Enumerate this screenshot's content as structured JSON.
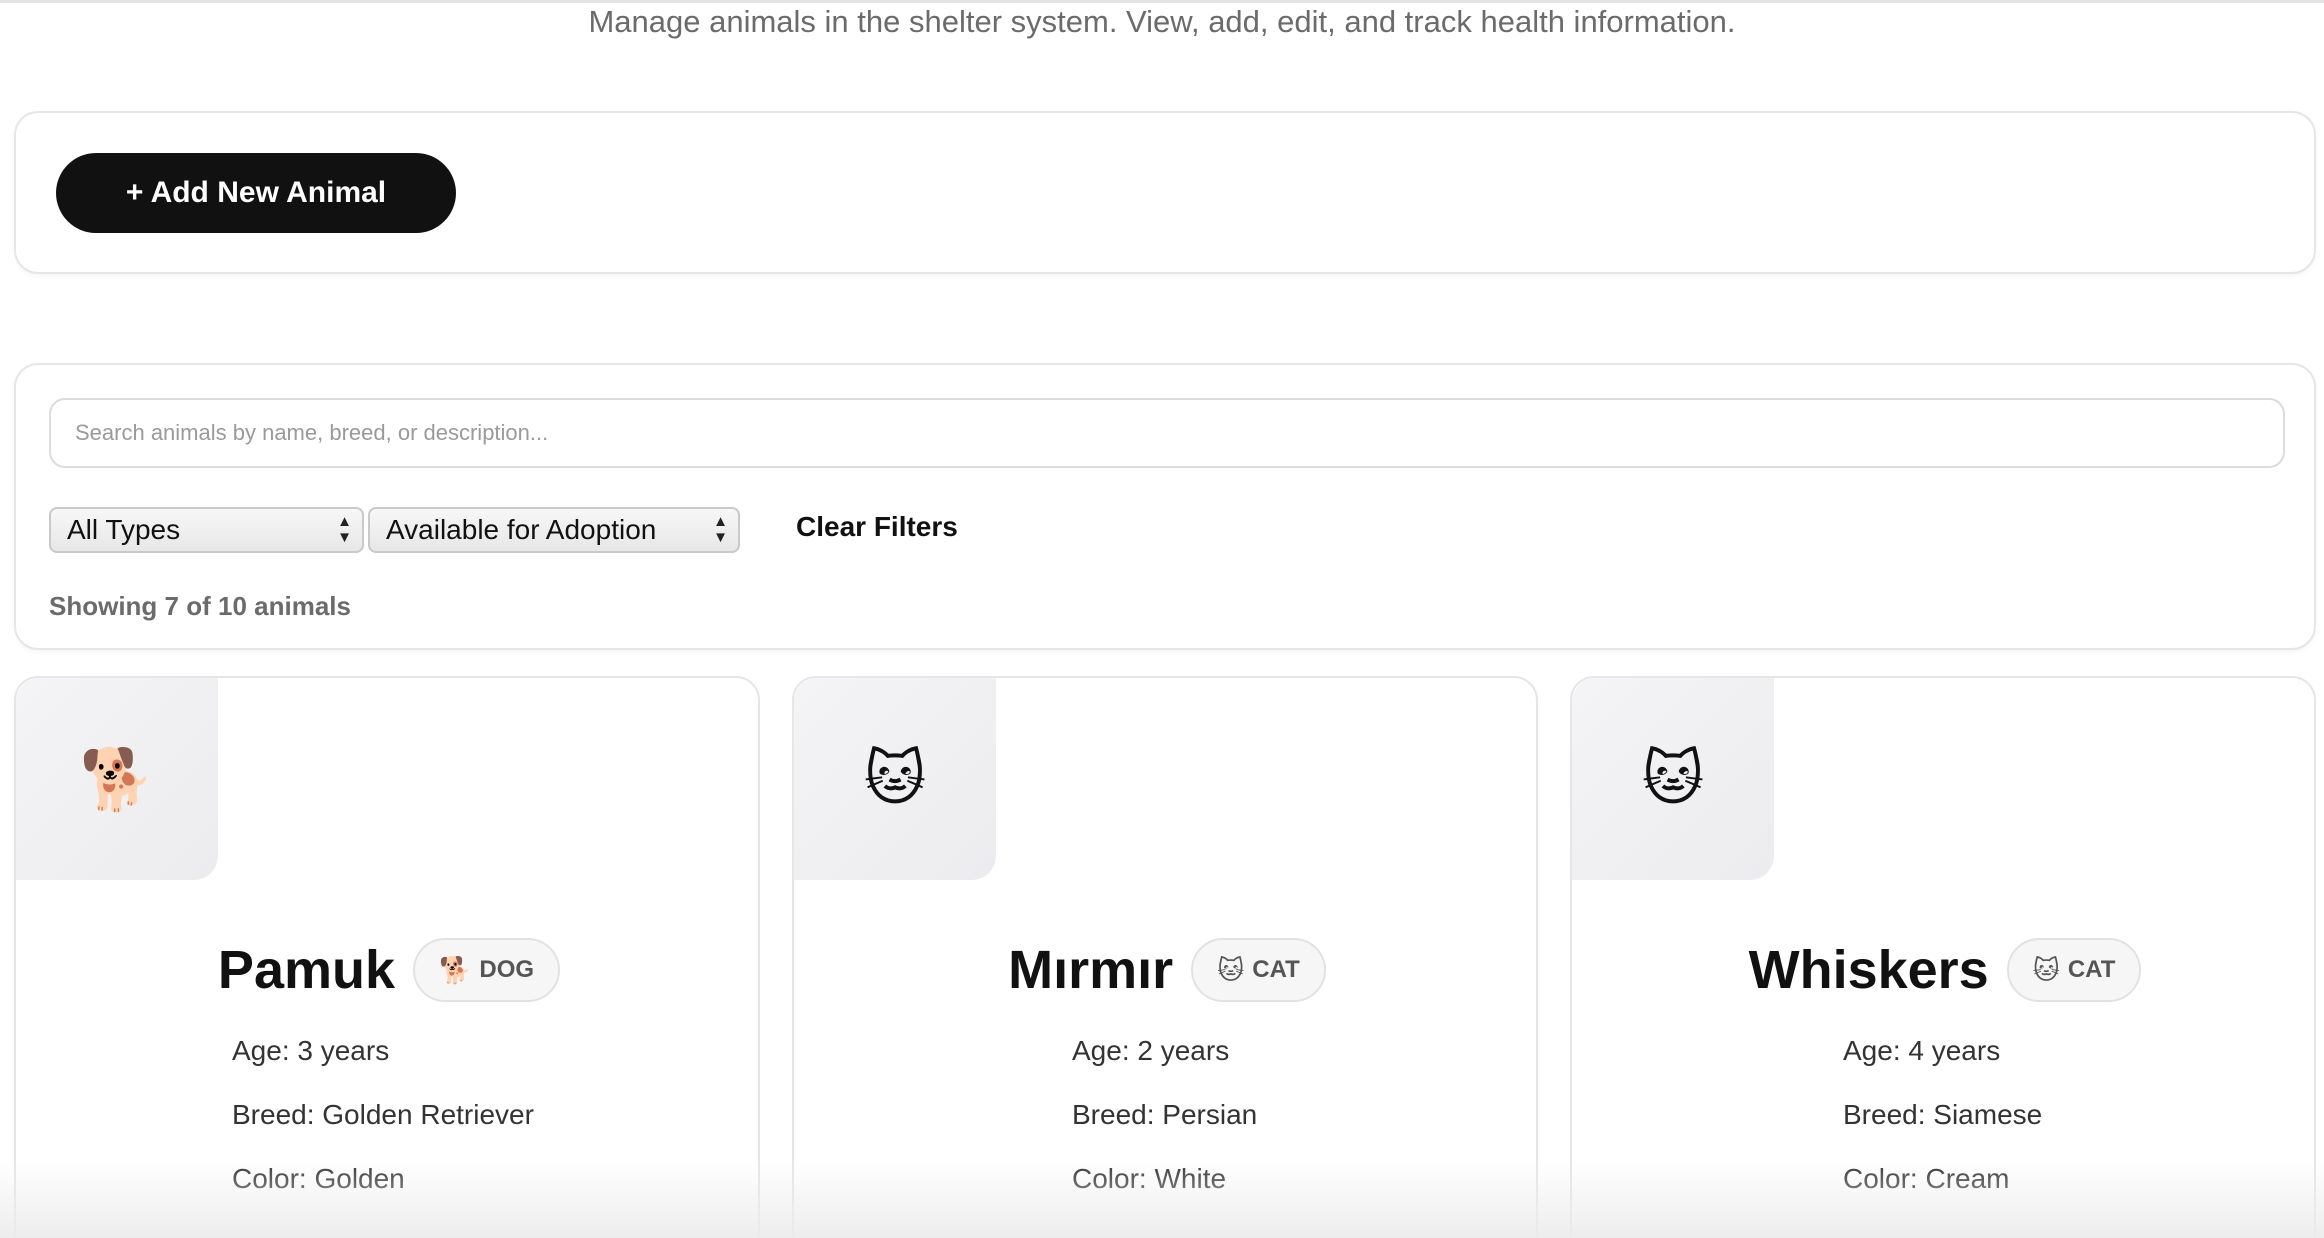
{
  "header": {
    "subtitle": "Manage animals in the shelter system. View, add, edit, and track health information."
  },
  "actions": {
    "add_label": "+ Add New Animal"
  },
  "filters": {
    "search_placeholder": "Search animals by name, breed, or description...",
    "type_selected": "All Types",
    "status_selected": "Available for Adoption",
    "clear_label": "Clear Filters",
    "count_text": "Showing 7 of 10 animals"
  },
  "animals": [
    {
      "name": "Pamuk",
      "type_label": "DOG",
      "type_icon": "dog-icon",
      "thumb_glyph": "🐕",
      "badge_glyph": "🐕",
      "age": "Age: 3 years",
      "breed": "Breed: Golden Retriever",
      "color": "Color: Golden"
    },
    {
      "name": "Mırmır",
      "type_label": "CAT",
      "type_icon": "cat-icon",
      "thumb_glyph": "🐱",
      "badge_glyph": "🐱",
      "age": "Age: 2 years",
      "breed": "Breed: Persian",
      "color": "Color: White"
    },
    {
      "name": "Whiskers",
      "type_label": "CAT",
      "type_icon": "cat-icon",
      "thumb_glyph": "🐱",
      "badge_glyph": "🐱",
      "age": "Age: 4 years",
      "breed": "Breed: Siamese",
      "color": "Color: Cream"
    }
  ],
  "colors": {
    "primary_button": "#111111",
    "muted_text": "#6b6b6b",
    "border": "#e6e6e6"
  }
}
